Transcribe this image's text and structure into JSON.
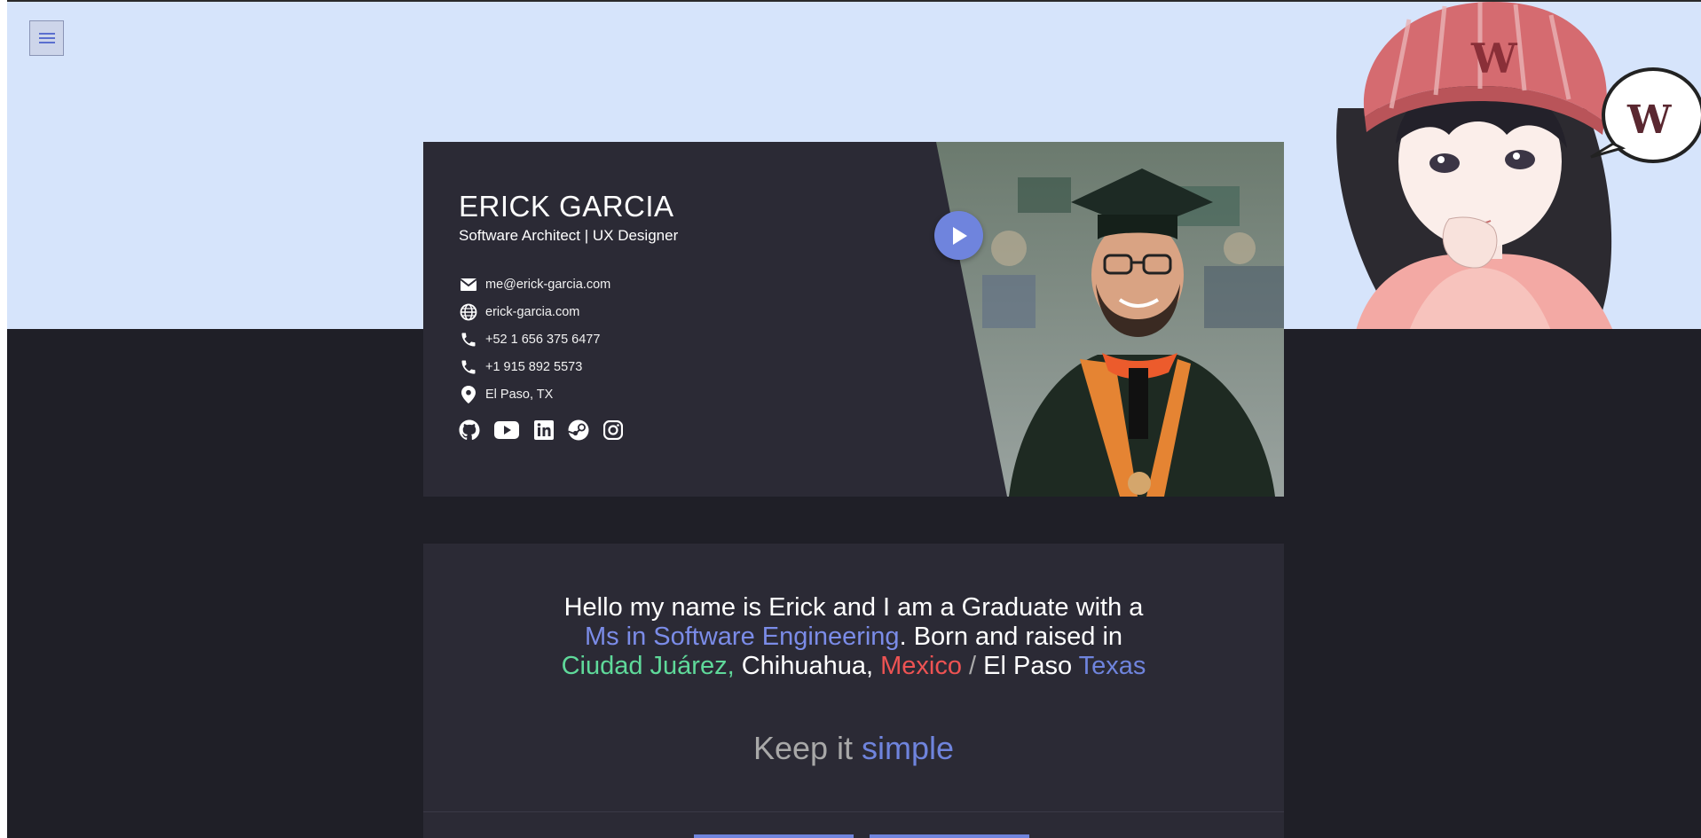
{
  "menu": {
    "icon": "hamburger-icon"
  },
  "profile": {
    "name": "ERICK GARCIA",
    "title": "Software Architect | UX Designer",
    "contacts": [
      {
        "icon": "mail-icon",
        "text": "me@erick-garcia.com"
      },
      {
        "icon": "globe-icon",
        "text": "erick-garcia.com"
      },
      {
        "icon": "phone-icon",
        "text": "+52 1 656 375 6477"
      },
      {
        "icon": "phone-icon",
        "text": "+1 915 892 5573"
      },
      {
        "icon": "location-pin-icon",
        "text": "El Paso, TX"
      }
    ],
    "socials": [
      "github-icon",
      "youtube-icon",
      "linkedin-icon",
      "steam-icon",
      "instagram-icon"
    ],
    "play_icon": "play-icon"
  },
  "about": {
    "line1": "Hello my name is Erick and I am a Graduate with a",
    "degree": "Ms in Software Engineering",
    "line2_rest": ". Born and raised in",
    "city": "Ciudad Juárez,",
    "state": " Chihuahua, ",
    "country": "Mexico",
    "slash": " / ",
    "us_city": "El Paso ",
    "us_state": "Texas",
    "motto_plain": "Keep it ",
    "motto_accent": "simple"
  },
  "colors": {
    "accent": "#6f84dd",
    "green": "#5fd99a",
    "red": "#ee5353",
    "card": "#2b2a35",
    "page": "#1f1f27",
    "hero": "#d6e4fb"
  }
}
